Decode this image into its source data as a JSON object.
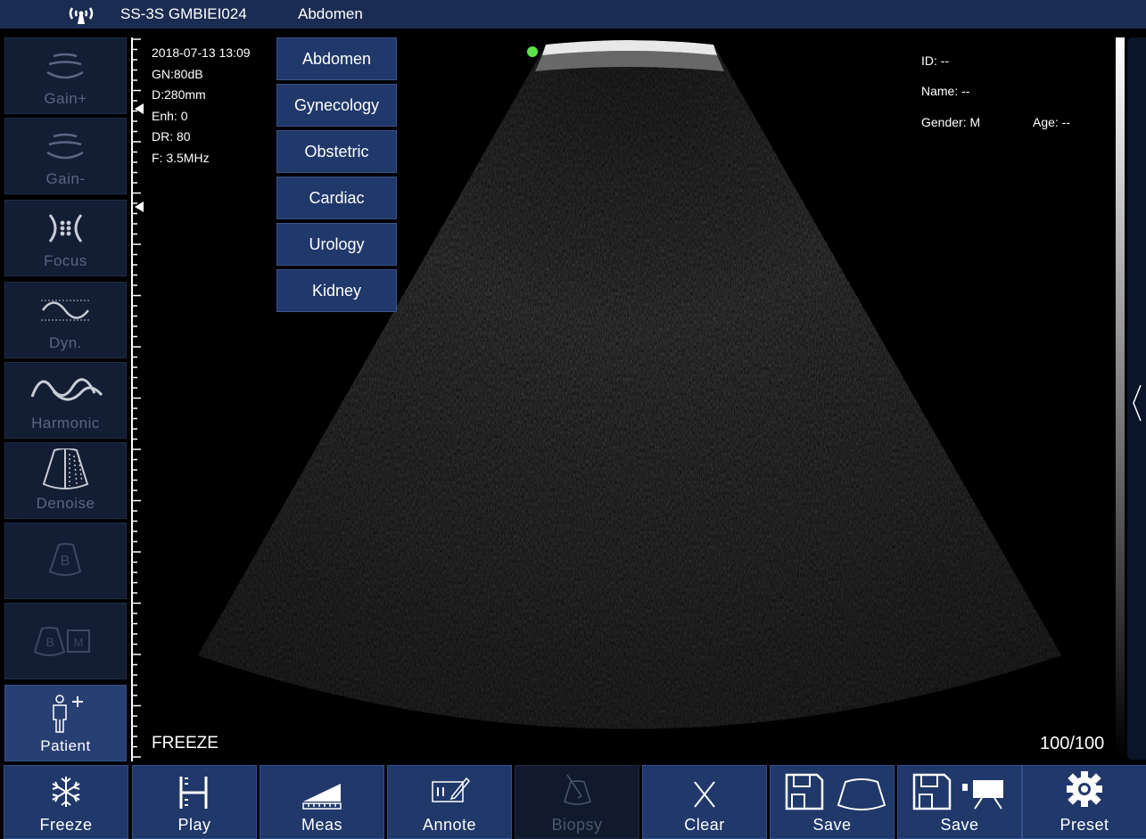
{
  "topbar": {
    "device": "SS-3S GMBIEI024",
    "preset": "Abdomen"
  },
  "sidebar": {
    "items": [
      {
        "label": "Gain+",
        "icon": "gain-up-icon"
      },
      {
        "label": "Gain-",
        "icon": "gain-down-icon"
      },
      {
        "label": "Focus",
        "icon": "focus-icon"
      },
      {
        "label": "Dyn.",
        "icon": "dynamic-range-icon"
      },
      {
        "label": "Harmonic",
        "icon": "harmonic-wave-icon"
      },
      {
        "label": "Denoise",
        "icon": "denoise-icon"
      },
      {
        "label": "",
        "icon": "b-mode-icon"
      },
      {
        "label": "",
        "icon": "bm-mode-icon"
      },
      {
        "label": "Patient",
        "icon": "patient-add-icon"
      }
    ]
  },
  "params": {
    "datetime": "2018-07-13 13:09",
    "gain": "GN:80dB",
    "depth": "D:280mm",
    "enhance": "Enh: 0",
    "dynamic_range": "DR: 80",
    "frequency": "F: 3.5MHz"
  },
  "preset_menu": [
    "Abdomen",
    "Gynecology",
    "Obstetric",
    "Cardiac",
    "Urology",
    "Kidney"
  ],
  "patient": {
    "id": "ID: --",
    "name": "Name: --",
    "gender": "Gender: M",
    "age": "Age: --"
  },
  "status": {
    "freeze": "FREEZE",
    "frames": "100/100"
  },
  "toolbar": [
    {
      "label": "Freeze",
      "icon": "snowflake-icon"
    },
    {
      "label": "Play",
      "icon": "play-cine-icon"
    },
    {
      "label": "Meas",
      "icon": "measure-ruler-icon"
    },
    {
      "label": "Annote",
      "icon": "annotate-icon"
    },
    {
      "label": "Biopsy",
      "icon": "biopsy-icon"
    },
    {
      "label": "Clear",
      "icon": "clear-x-icon"
    },
    {
      "label": "Save",
      "icon": "save-image-icon"
    },
    {
      "label": "Save",
      "icon": "save-video-icon"
    },
    {
      "label": "Preset",
      "icon": "gear-icon"
    }
  ],
  "colors": {
    "topbar": "#1b2c52",
    "button": "#20386a",
    "disabled": "#111a2d",
    "probe_indicator": "#5ce34a"
  }
}
